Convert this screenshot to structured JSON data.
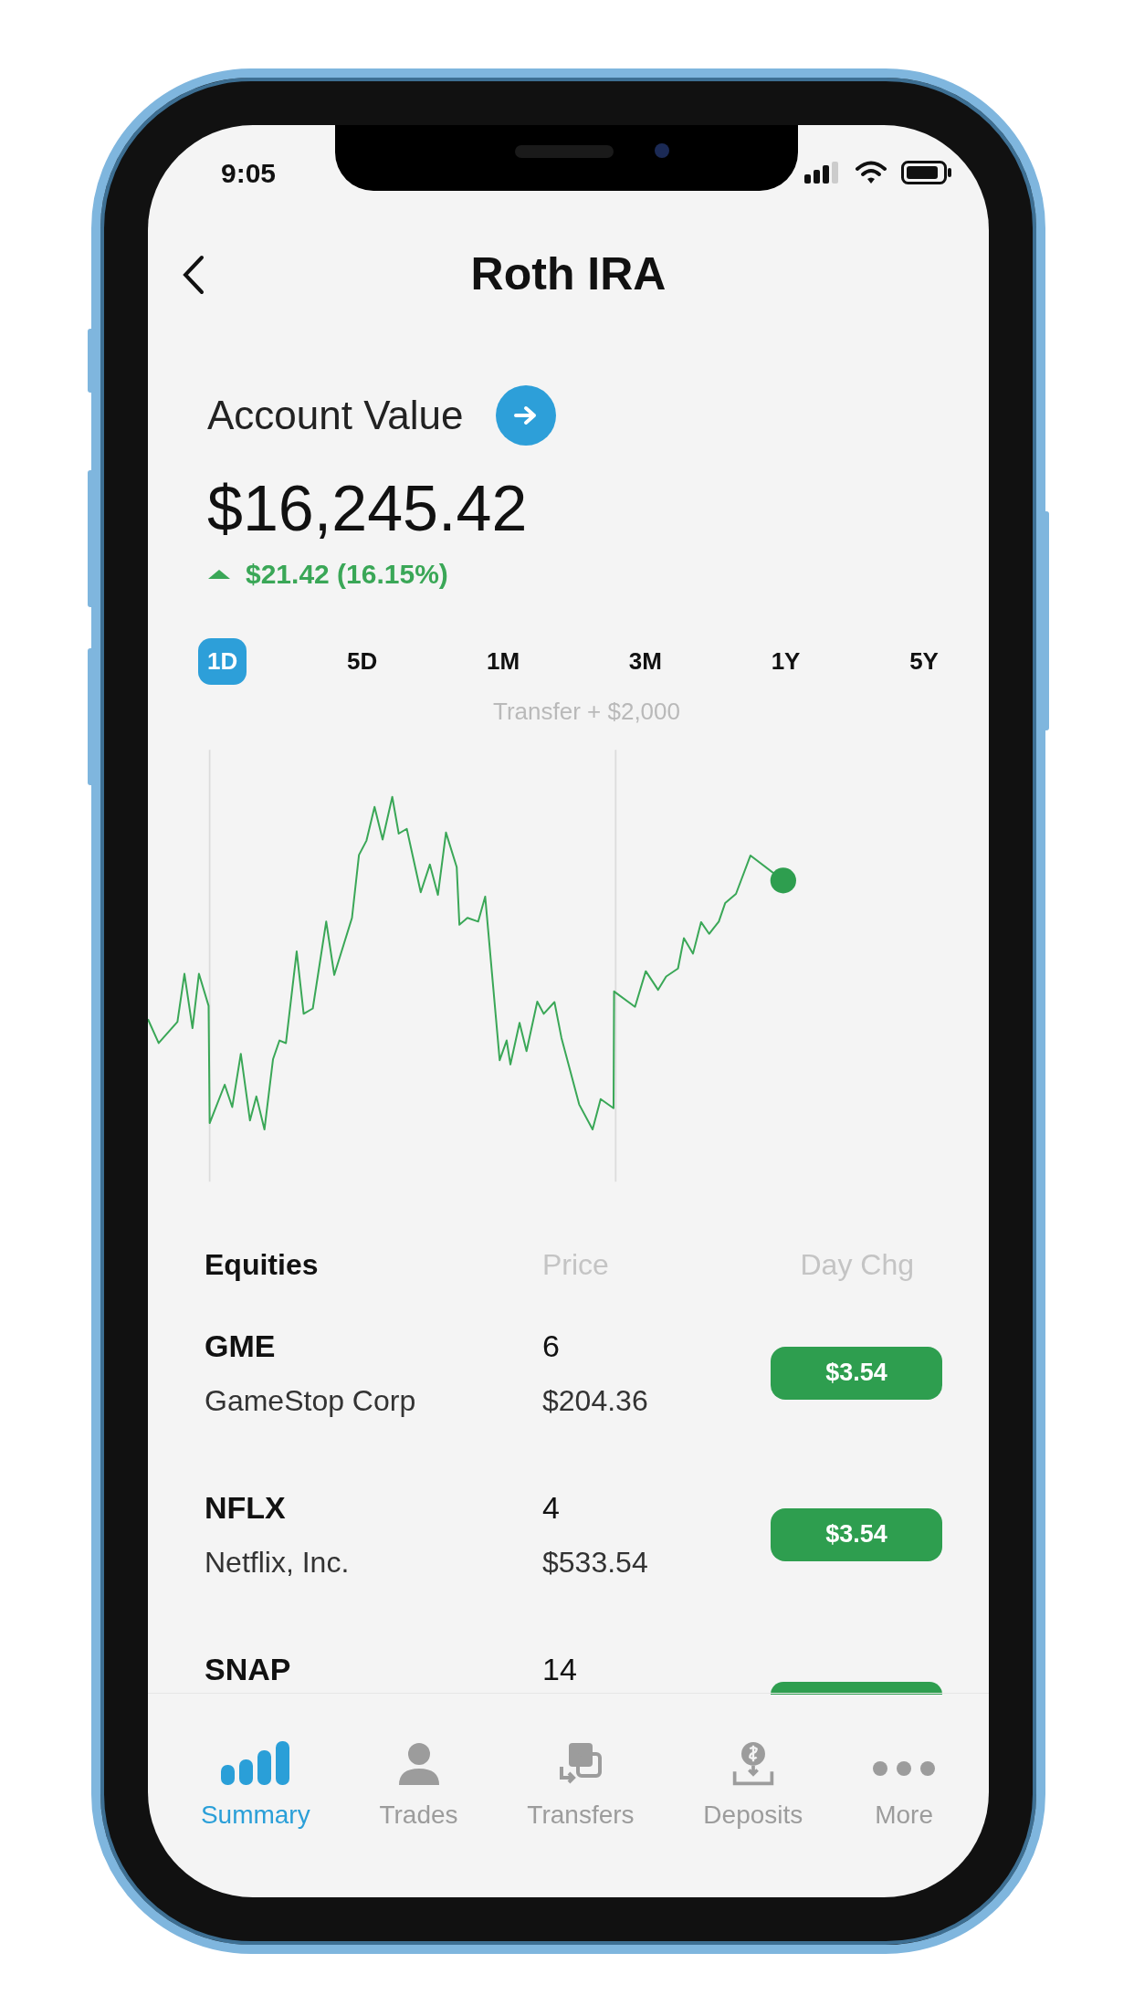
{
  "status_bar": {
    "time": "9:05"
  },
  "header": {
    "title": "Roth IRA"
  },
  "account": {
    "label": "Account Value",
    "value": "$16,245.42",
    "change": "$21.42 (16.15%)"
  },
  "ranges": [
    {
      "label": "1D",
      "selected": true
    },
    {
      "label": "5D",
      "selected": false
    },
    {
      "label": "1M",
      "selected": false
    },
    {
      "label": "3M",
      "selected": false
    },
    {
      "label": "1Y",
      "selected": false
    },
    {
      "label": "5Y",
      "selected": false
    }
  ],
  "chart": {
    "annotation": "Transfer + $2,000"
  },
  "equities": {
    "columns": [
      "Equities",
      "Price",
      "Day Chg"
    ],
    "rows": [
      {
        "symbol": "GME",
        "name": "GameStop Corp",
        "shares": "6",
        "price": "$204.36",
        "change": "$3.54"
      },
      {
        "symbol": "NFLX",
        "name": "Netflix, Inc.",
        "shares": "4",
        "price": "$533.54",
        "change": "$3.54"
      },
      {
        "symbol": "SNAP",
        "shares": "14"
      }
    ]
  },
  "tab_bar": [
    {
      "label": "Summary",
      "selected": true
    },
    {
      "label": "Trades",
      "selected": false
    },
    {
      "label": "Transfers",
      "selected": false
    },
    {
      "label": "Deposits",
      "selected": false
    },
    {
      "label": "More",
      "selected": false
    }
  ]
}
